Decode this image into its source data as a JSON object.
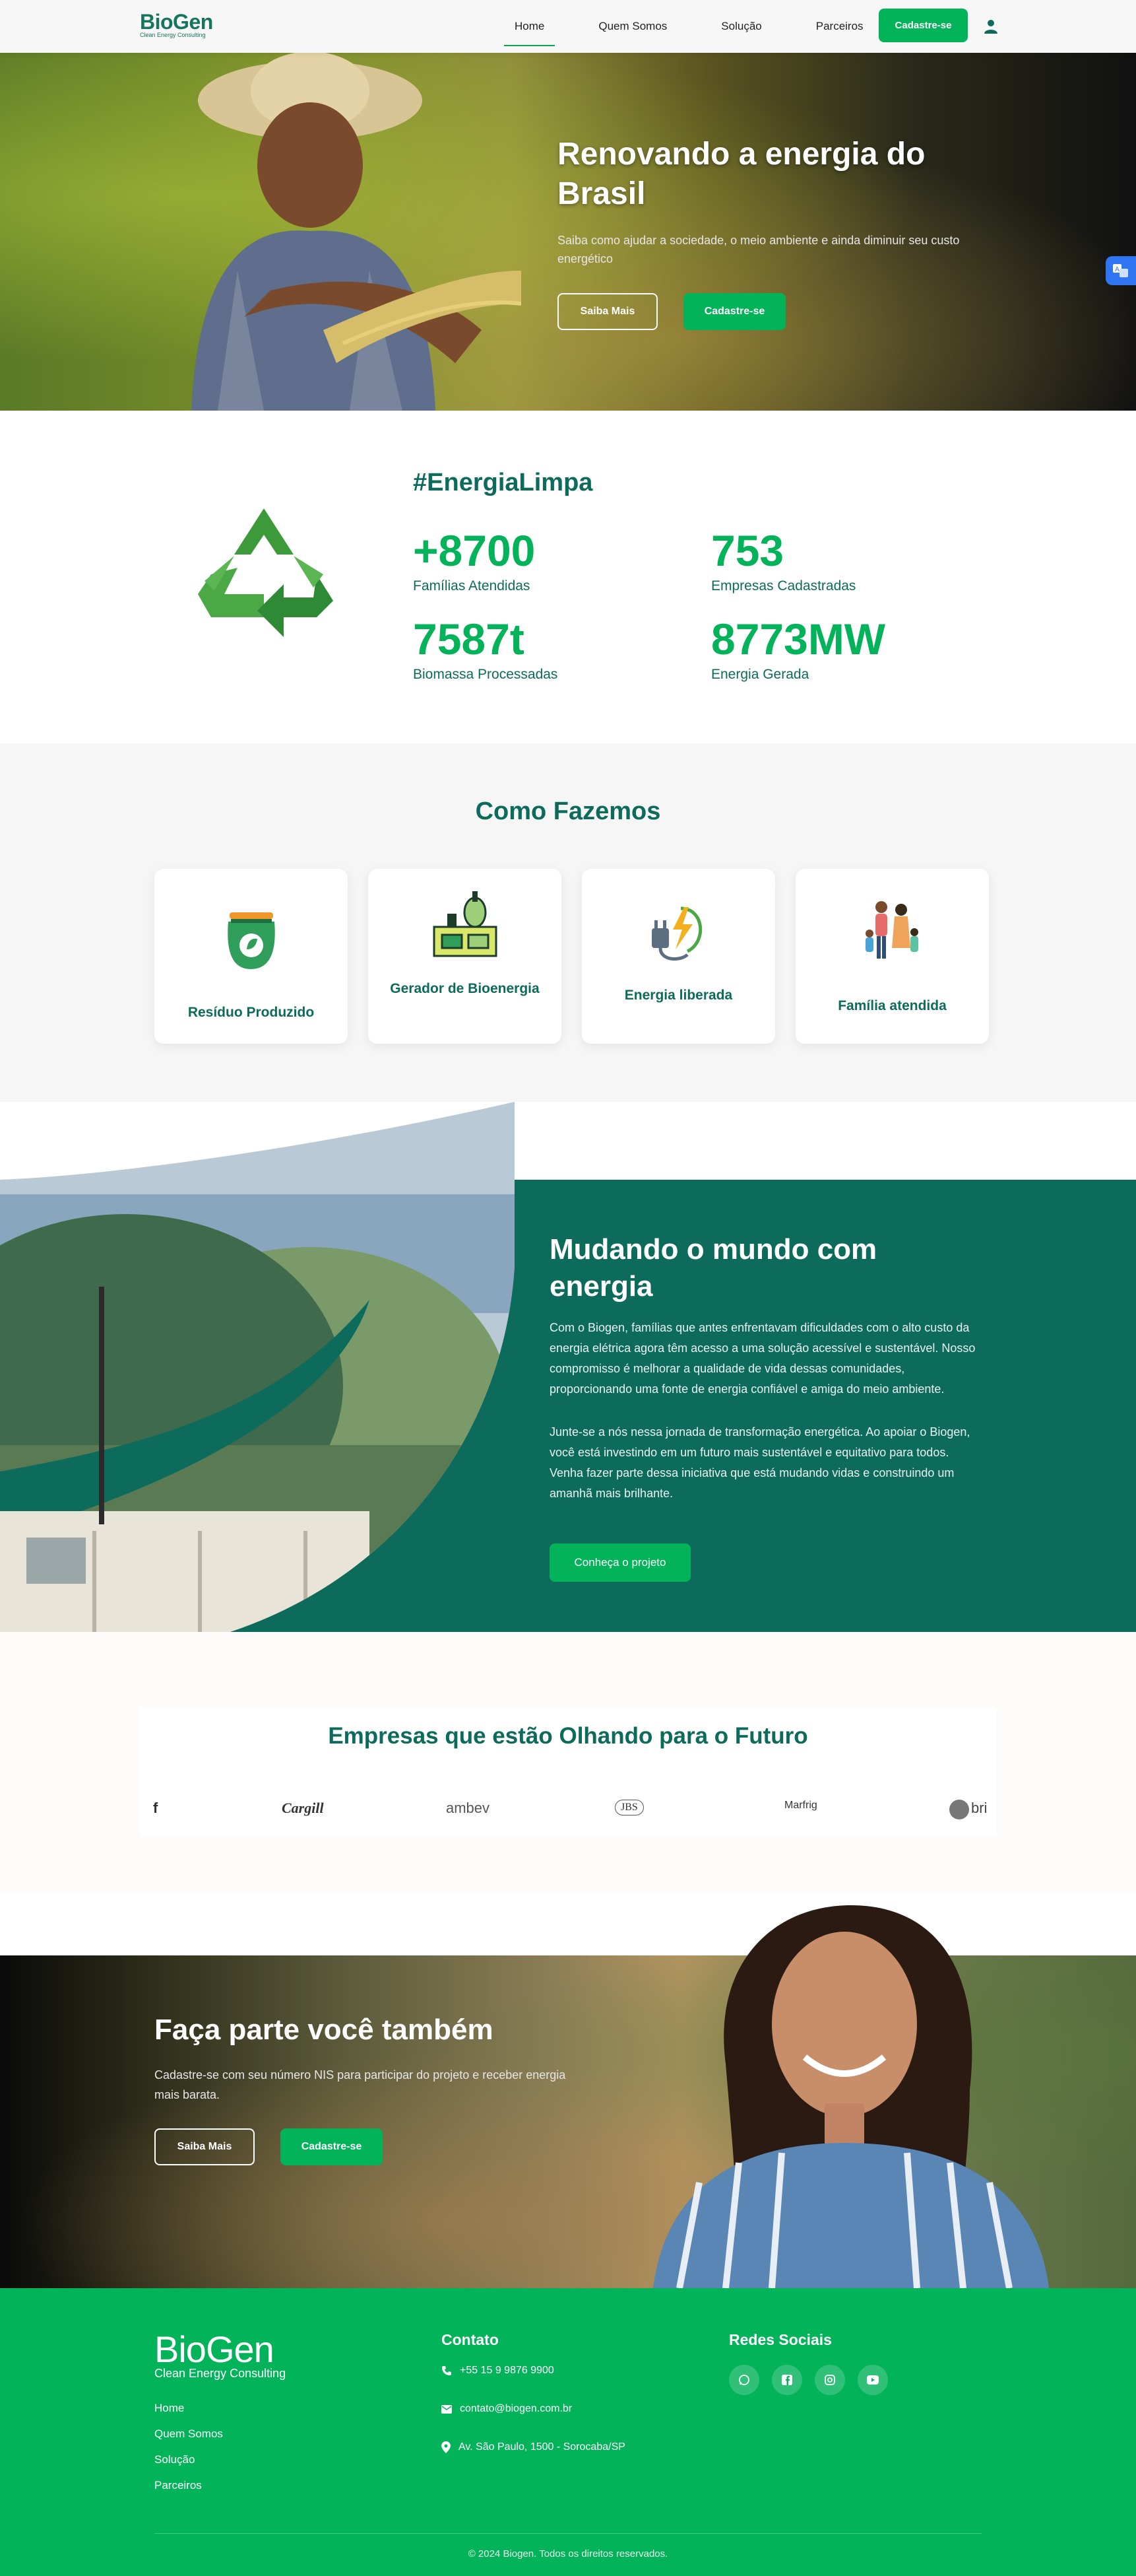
{
  "nav": {
    "logo": "BioGen",
    "logo_tagline": "Clean Energy Consulting",
    "links": [
      "Home",
      "Quem Somos",
      "Solução",
      "Parceiros"
    ],
    "cta": "Cadastre-se"
  },
  "hero": {
    "title": "Renovando a energia do Brasil",
    "subtitle": "Saiba como ajudar a sociedade, o meio ambiente e ainda diminuir seu custo energético",
    "btn_more": "Saiba Mais",
    "btn_signup": "Cadastre-se"
  },
  "stats": {
    "hashtag": "#EnergiaLimpa",
    "items": [
      {
        "value": "+8700",
        "label": "Famílias Atendidas"
      },
      {
        "value": "753",
        "label": "Empresas Cadastradas"
      },
      {
        "value": "7587t",
        "label": "Biomassa Processadas"
      },
      {
        "value": "8773MW",
        "label": "Energia Gerada"
      }
    ]
  },
  "como": {
    "title": "Como Fazemos",
    "cards": [
      "Resíduo Produzido",
      "Gerador de Bioenergia",
      "Energia liberada",
      "Família atendida"
    ]
  },
  "mudando": {
    "title": "Mudando o mundo com energia",
    "p1": "Com o Biogen, famílias que antes enfrentavam dificuldades com o alto custo da energia elétrica agora têm acesso a uma solução acessível e sustentável. Nosso compromisso é melhorar a qualidade de vida dessas comunidades, proporcionando uma fonte de energia confiável e amiga do meio ambiente.",
    "p2": "Junte-se a nós nessa jornada de transformação energética. Ao apoiar o Biogen, você está investindo em um futuro mais sustentável e equitativo para todos. Venha fazer parte dessa iniciativa que está mudando vidas e construindo um amanhã mais brilhante.",
    "btn": "Conheça o projeto"
  },
  "empresas": {
    "title": "Empresas que estão Olhando para o Futuro",
    "brands": [
      "f",
      "Cargill",
      "ambev",
      "JBS",
      "Marfrig",
      "bri"
    ]
  },
  "faca": {
    "title": "Faça parte você também",
    "subtitle": "Cadastre-se com seu número NIS para participar do projeto e receber energia mais barata.",
    "btn_more": "Saiba Mais",
    "btn_signup": "Cadastre-se"
  },
  "footer": {
    "logo": "BioGen",
    "logo_tagline": "Clean Energy Consulting",
    "links": [
      "Home",
      "Quem Somos",
      "Solução",
      "Parceiros"
    ],
    "contact_title": "Contato",
    "phone": "+55 15 9 9876 9900",
    "email": "contato@biogen.com.br",
    "address": "Av. São Paulo, 1500 - Sorocaba/SP",
    "social_title": "Redes Sociais",
    "social_icons": [
      "whatsapp-icon",
      "facebook-icon",
      "instagram-icon",
      "youtube-icon"
    ],
    "copyright": "© 2024 Biogen. Todos os direitos reservados."
  },
  "colors": {
    "primary_green": "#03b35a",
    "dark_teal": "#0d6b5c",
    "widget_blue": "#2f74f0"
  }
}
